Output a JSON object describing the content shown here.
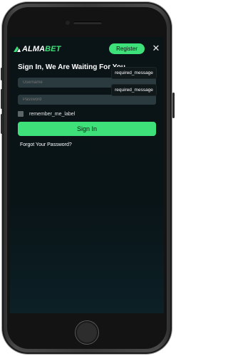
{
  "header": {
    "logo_prefix": "ALMA",
    "logo_suffix": "BET",
    "register_label": "Register",
    "close_glyph": "✕"
  },
  "login": {
    "title": "Sign In, We Are Waiting For You",
    "username_placeholder": "Username",
    "password_placeholder": "Password",
    "username_tooltip": "required_message",
    "password_tooltip": "required_message",
    "remember_label": "remember_me_label",
    "remember_checked": false,
    "signin_label": "Sign In",
    "forgot_label": "Forgot Your Password?"
  },
  "colors": {
    "accent": "#3ee07a",
    "screen_bg": "#0a1316",
    "field_bg": "#2b3a3e",
    "tooltip_bg": "#10181a"
  },
  "icons": {
    "logo": "almabet-logo-icon",
    "close": "close-icon",
    "home": "home-button"
  }
}
